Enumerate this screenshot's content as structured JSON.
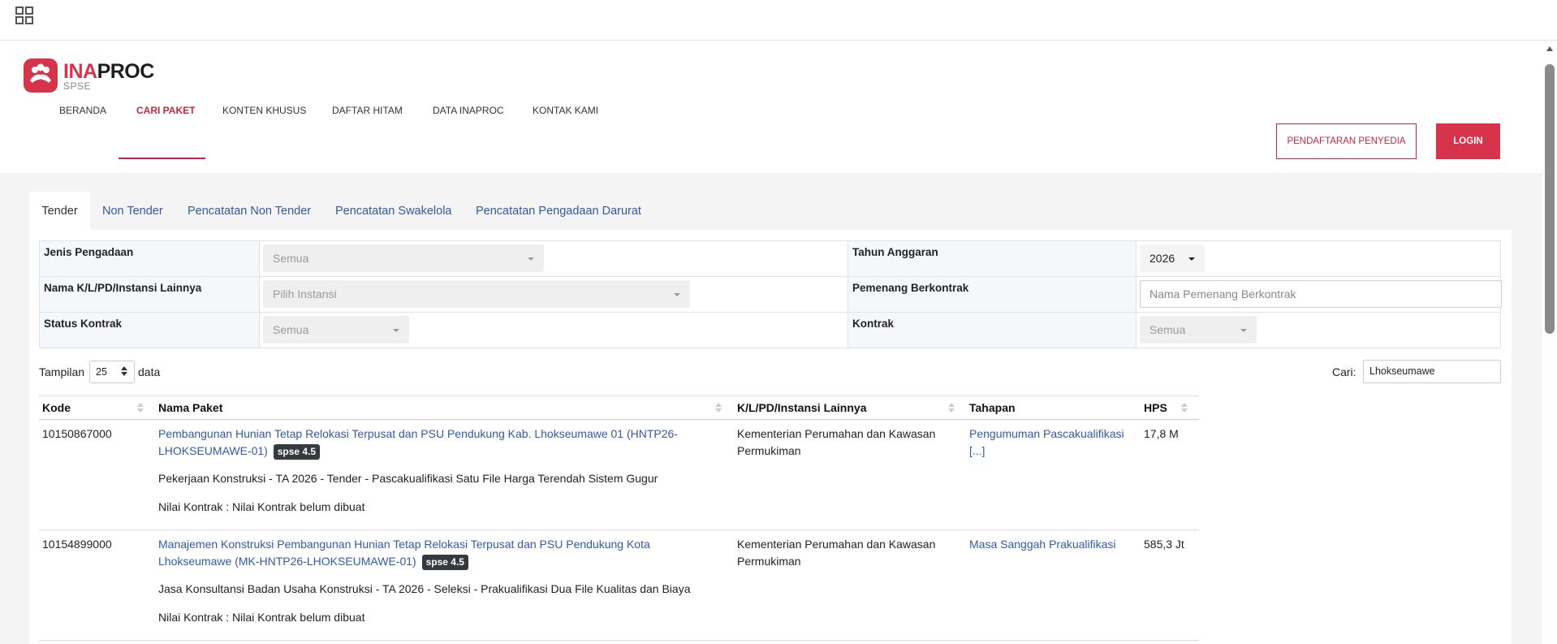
{
  "topbar": {
    "apps_icon": "grid-apps-icon"
  },
  "brand": {
    "name_part1": "INA",
    "name_part2": "PROC",
    "subtitle": "SPSE",
    "icon": "people-handshake-icon",
    "color": "#d7334b"
  },
  "nav": {
    "items": [
      "BERANDA",
      "CARI PAKET",
      "KONTEN KHUSUS",
      "DAFTAR HITAM",
      "DATA INAPROC",
      "KONTAK KAMI"
    ],
    "active": "CARI PAKET",
    "register_label": "PENDAFTARAN PENYEDIA",
    "login_label": "LOGIN"
  },
  "tabs": {
    "items": [
      "Tender",
      "Non Tender",
      "Pencatatan Non Tender",
      "Pencatatan Swakelola",
      "Pencatatan Pengadaan Darurat"
    ],
    "active": "Tender"
  },
  "filters": {
    "jenis_label": "Jenis Pengadaan",
    "jenis_value": "Semua",
    "tahun_label": "Tahun Anggaran",
    "tahun_value": "2026",
    "instansi_label": "Nama K/L/PD/Instansi Lainnya",
    "instansi_value": "Pilih Instansi",
    "pemenang_label": "Pemenang Berkontrak",
    "pemenang_placeholder": "Nama Pemenang Berkontrak",
    "status_label": "Status Kontrak",
    "status_value": "Semua",
    "kontrak_label": "Kontrak",
    "kontrak_value": "Semua"
  },
  "table_controls": {
    "show_label": "Tampilan",
    "page_length": "25",
    "data_label": "data",
    "search_label": "Cari:",
    "search_value": "Lhokseumawe"
  },
  "table": {
    "columns": [
      "Kode",
      "Nama Paket",
      "K/L/PD/Instansi Lainnya",
      "Tahapan",
      "HPS"
    ],
    "rows": [
      {
        "kode": "10150867000",
        "nama_line1": "Pembangunan Hunian Tetap Relokasi Terpusat dan PSU Pendukung Kab. Lhokseumawe 01 (HNTP26-",
        "nama_line2": "LHOKSEUMAWE-01)",
        "badge": "spse 4.5",
        "desc": "Pekerjaan Konstruksi - TA 2026 - Tender - Pascakualifikasi Satu File Harga Terendah Sistem Gugur",
        "nilai": "Nilai Kontrak : Nilai Kontrak belum dibuat",
        "instansi_line1": "Kementerian Perumahan dan Kawasan",
        "instansi_line2": "Permukiman",
        "tahapan_line1": "Pengumuman Pascakualifikasi",
        "tahapan_line2": "[...]",
        "hps": "17,8 M"
      },
      {
        "kode": "10154899000",
        "nama_line1": "Manajemen Konstruksi Pembangunan Hunian Tetap Relokasi Terpusat dan PSU Pendukung Kota",
        "nama_line2": "Lhokseumawe (MK-HNTP26-LHOKSEUMAWE-01)",
        "badge": "spse 4.5",
        "desc": "Jasa Konsultansi Badan Usaha Konstruksi - TA 2026 - Seleksi - Prakualifikasi Dua File Kualitas dan Biaya",
        "nilai": "Nilai Kontrak : Nilai Kontrak belum dibuat",
        "instansi_line1": "Kementerian Perumahan dan Kawasan",
        "instansi_line2": "Permukiman",
        "tahapan_line1": "Masa Sanggah Prakualifikasi",
        "tahapan_line2": "",
        "hps": "585,3 Jt"
      }
    ]
  }
}
